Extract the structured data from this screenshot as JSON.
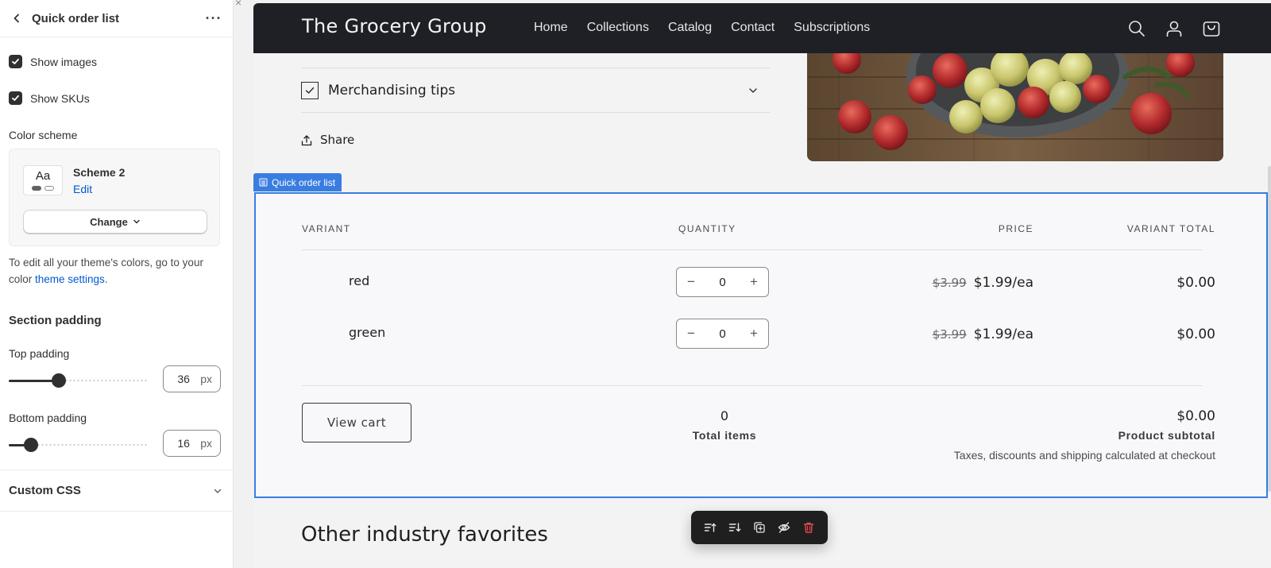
{
  "panel": {
    "title": "Quick order list",
    "more": "···",
    "close": "×",
    "show_images": {
      "label": "Show images",
      "checked": true
    },
    "show_skus": {
      "label": "Show SKUs",
      "checked": true
    },
    "color_scheme_label": "Color scheme",
    "scheme": {
      "preview_text": "Aa",
      "name": "Scheme 2",
      "edit_label": "Edit",
      "change_label": "Change"
    },
    "help": {
      "prefix": "To edit all your theme's colors, go to your color ",
      "link": "theme settings",
      "suffix": "."
    },
    "section_padding_title": "Section padding",
    "top_padding": {
      "label": "Top padding",
      "value": "36",
      "unit": "px",
      "level": 0.36
    },
    "bottom_padding": {
      "label": "Bottom padding",
      "value": "16",
      "unit": "px",
      "level": 0.16
    },
    "custom_css_label": "Custom CSS"
  },
  "store": {
    "brand": "The Grocery Group",
    "nav": [
      "Home",
      "Collections",
      "Catalog",
      "Contact",
      "Subscriptions"
    ],
    "nav_bg": "#1f2026"
  },
  "product": {
    "accordion_label": "Merchandising tips",
    "share_label": "Share"
  },
  "section_tag": "Quick order list",
  "quick_order": {
    "headers": {
      "variant": "VARIANT",
      "quantity": "QUANTITY",
      "price": "PRICE",
      "total": "VARIANT TOTAL"
    },
    "rows": [
      {
        "variant": "red",
        "qty_minus": "−",
        "qty": "0",
        "qty_plus": "+",
        "compare_price": "$3.99",
        "price": "$1.99/ea",
        "total": "$0.00"
      },
      {
        "variant": "green",
        "qty_minus": "−",
        "qty": "0",
        "qty_plus": "+",
        "compare_price": "$3.99",
        "price": "$1.99/ea",
        "total": "$0.00"
      }
    ],
    "view_cart": "View cart",
    "total_items_value": "0",
    "total_items_label": "Total items",
    "subtotal_value": "$0.00",
    "subtotal_label": "Product subtotal",
    "note": "Taxes, discounts and shipping calculated at checkout"
  },
  "other_title": "Other industry favorites",
  "colors": {
    "accent": "#3a7de1",
    "link": "#005bd3",
    "delete": "#e5484d"
  },
  "toolbar_icons": [
    "move-up-icon",
    "move-down-icon",
    "duplicate-icon",
    "hide-icon",
    "delete-icon"
  ]
}
